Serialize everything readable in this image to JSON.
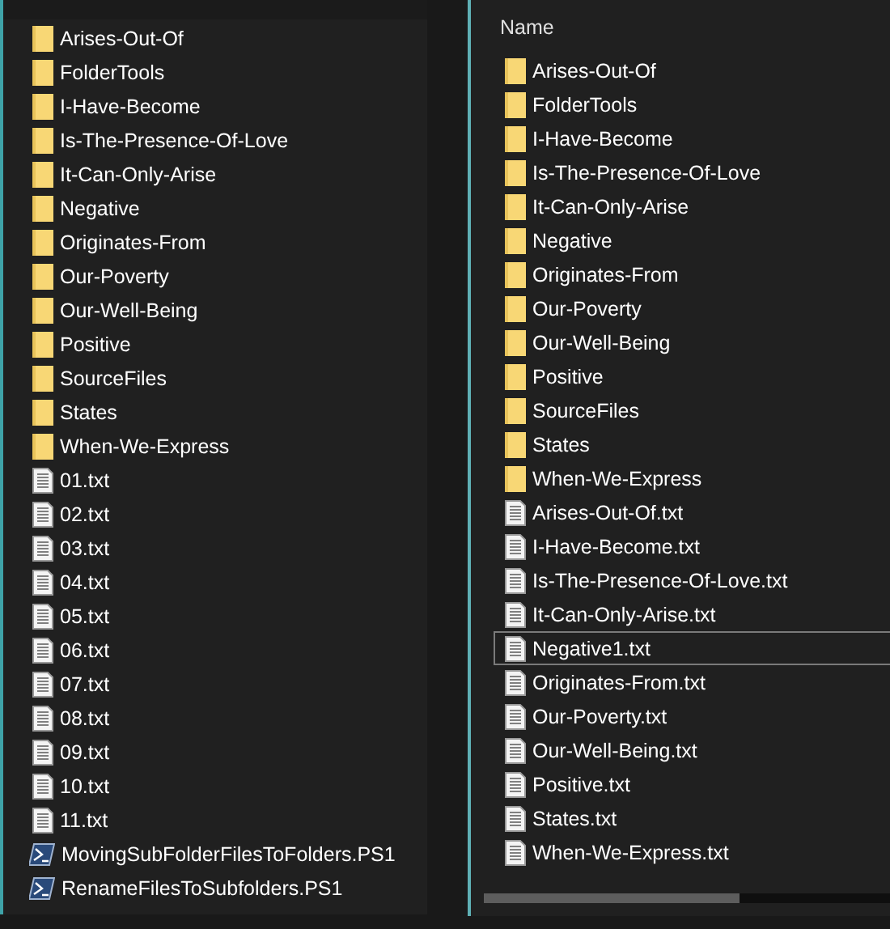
{
  "left_pane": {
    "items": [
      {
        "name": "Arises-Out-Of",
        "kind": "folder"
      },
      {
        "name": "FolderTools",
        "kind": "folder"
      },
      {
        "name": "I-Have-Become",
        "kind": "folder"
      },
      {
        "name": "Is-The-Presence-Of-Love",
        "kind": "folder"
      },
      {
        "name": "It-Can-Only-Arise",
        "kind": "folder"
      },
      {
        "name": "Negative",
        "kind": "folder"
      },
      {
        "name": "Originates-From",
        "kind": "folder"
      },
      {
        "name": "Our-Poverty",
        "kind": "folder"
      },
      {
        "name": "Our-Well-Being",
        "kind": "folder"
      },
      {
        "name": "Positive",
        "kind": "folder"
      },
      {
        "name": "SourceFiles",
        "kind": "folder"
      },
      {
        "name": "States",
        "kind": "folder"
      },
      {
        "name": "When-We-Express",
        "kind": "folder"
      },
      {
        "name": "01.txt",
        "kind": "text"
      },
      {
        "name": "02.txt",
        "kind": "text"
      },
      {
        "name": "03.txt",
        "kind": "text"
      },
      {
        "name": "04.txt",
        "kind": "text"
      },
      {
        "name": "05.txt",
        "kind": "text"
      },
      {
        "name": "06.txt",
        "kind": "text"
      },
      {
        "name": "07.txt",
        "kind": "text"
      },
      {
        "name": "08.txt",
        "kind": "text"
      },
      {
        "name": "09.txt",
        "kind": "text"
      },
      {
        "name": "10.txt",
        "kind": "text"
      },
      {
        "name": "11.txt",
        "kind": "text"
      },
      {
        "name": "MovingSubFolderFilesToFolders.PS1",
        "kind": "script"
      },
      {
        "name": "RenameFilesToSubfolders.PS1",
        "kind": "script"
      }
    ]
  },
  "right_pane": {
    "column_header": "Name",
    "items": [
      {
        "name": "Arises-Out-Of",
        "kind": "folder",
        "focused": false
      },
      {
        "name": "FolderTools",
        "kind": "folder",
        "focused": false
      },
      {
        "name": "I-Have-Become",
        "kind": "folder",
        "focused": false
      },
      {
        "name": "Is-The-Presence-Of-Love",
        "kind": "folder",
        "focused": false
      },
      {
        "name": "It-Can-Only-Arise",
        "kind": "folder",
        "focused": false
      },
      {
        "name": "Negative",
        "kind": "folder",
        "focused": false
      },
      {
        "name": "Originates-From",
        "kind": "folder",
        "focused": false
      },
      {
        "name": "Our-Poverty",
        "kind": "folder",
        "focused": false
      },
      {
        "name": "Our-Well-Being",
        "kind": "folder",
        "focused": false
      },
      {
        "name": "Positive",
        "kind": "folder",
        "focused": false
      },
      {
        "name": "SourceFiles",
        "kind": "folder",
        "focused": false
      },
      {
        "name": "States",
        "kind": "folder",
        "focused": false
      },
      {
        "name": "When-We-Express",
        "kind": "folder",
        "focused": false
      },
      {
        "name": "Arises-Out-Of.txt",
        "kind": "text",
        "focused": false
      },
      {
        "name": "I-Have-Become.txt",
        "kind": "text",
        "focused": false
      },
      {
        "name": "Is-The-Presence-Of-Love.txt",
        "kind": "text",
        "focused": false
      },
      {
        "name": "It-Can-Only-Arise.txt",
        "kind": "text",
        "focused": false
      },
      {
        "name": "Negative1.txt",
        "kind": "text",
        "focused": true
      },
      {
        "name": "Originates-From.txt",
        "kind": "text",
        "focused": false
      },
      {
        "name": "Our-Poverty.txt",
        "kind": "text",
        "focused": false
      },
      {
        "name": "Our-Well-Being.txt",
        "kind": "text",
        "focused": false
      },
      {
        "name": "Positive.txt",
        "kind": "text",
        "focused": false
      },
      {
        "name": "States.txt",
        "kind": "text",
        "focused": false
      },
      {
        "name": "When-We-Express.txt",
        "kind": "text",
        "focused": false
      }
    ]
  }
}
